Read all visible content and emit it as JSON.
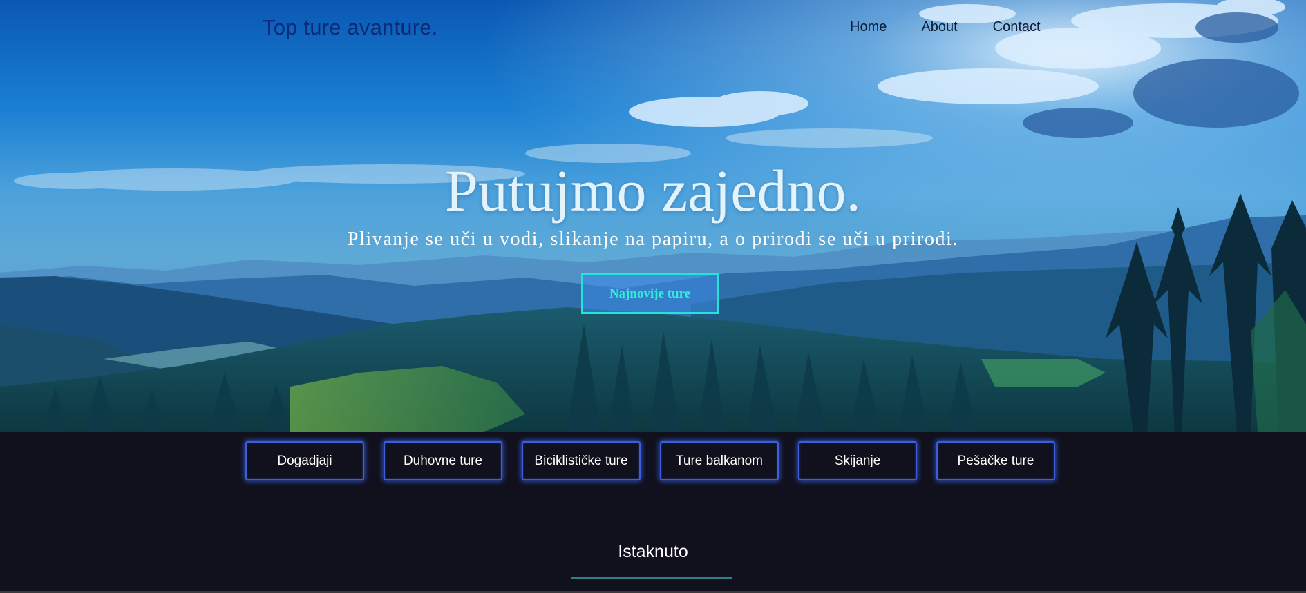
{
  "header": {
    "brand": "Top ture avanture.",
    "nav": [
      "Home",
      "About",
      "Contact"
    ]
  },
  "hero": {
    "title": "Putujmo zajedno.",
    "subtitle": "Plivanje se uči u vodi, slikanje na papiru, a o prirodi se uči u prirodi.",
    "cta_label": "Najnovije ture"
  },
  "categories": [
    "Dogadjaji",
    "Duhovne ture",
    "Biciklističke ture",
    "Ture balkanom",
    "Skijanje",
    "Pešačke ture"
  ],
  "section": {
    "title": "Istaknuto"
  },
  "colors": {
    "page_background": "#11101d",
    "cta_border": "#22e4d8",
    "category_glow": "#3a5fd8",
    "section_rule": "#2f7f8f"
  }
}
